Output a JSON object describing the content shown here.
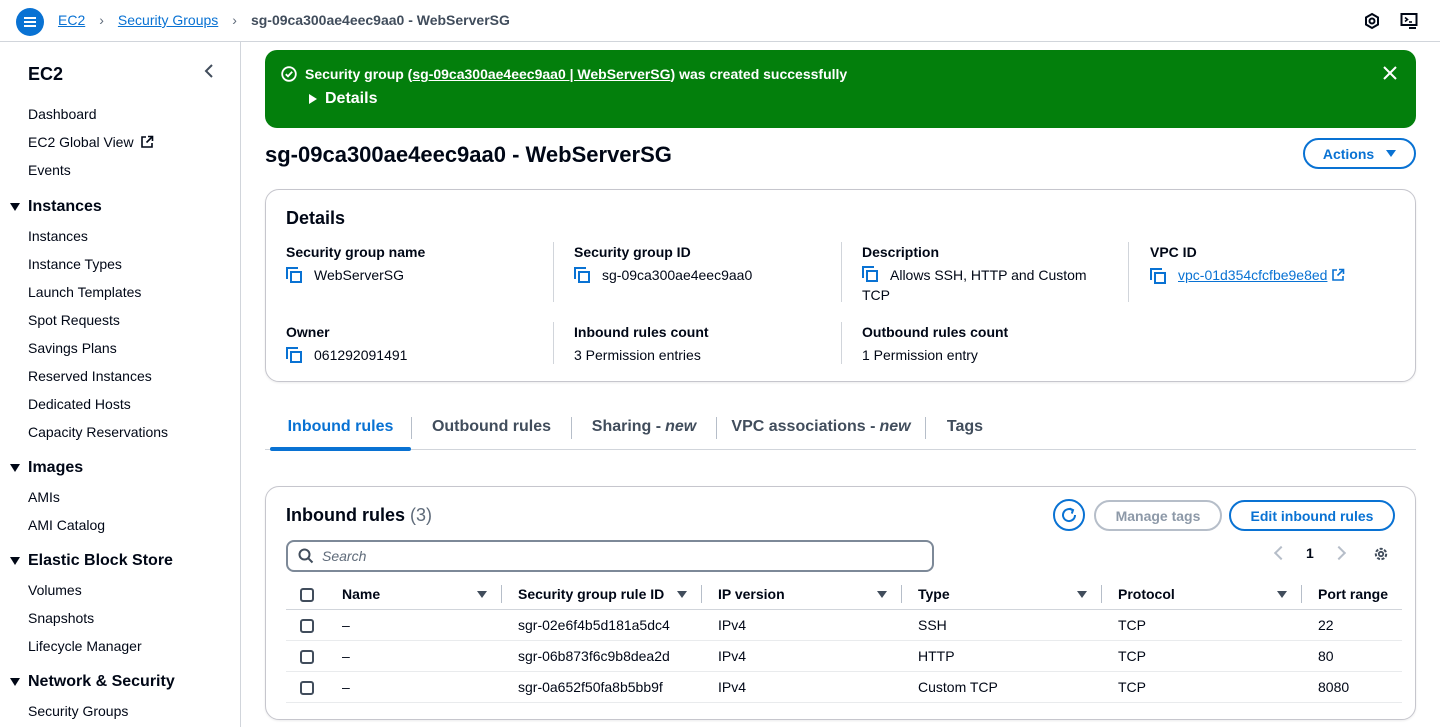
{
  "breadcrumb": {
    "root": "EC2",
    "section": "Security Groups",
    "current": "sg-09ca300ae4eec9aa0 - WebServerSG"
  },
  "topbar_icons": [
    "settings-hex-icon",
    "cloudshell-icon"
  ],
  "sidebar": {
    "title": "EC2",
    "top_items": [
      "Dashboard",
      "EC2 Global View",
      "Events"
    ],
    "sections": [
      {
        "title": "Instances",
        "items": [
          "Instances",
          "Instance Types",
          "Launch Templates",
          "Spot Requests",
          "Savings Plans",
          "Reserved Instances",
          "Dedicated Hosts",
          "Capacity Reservations"
        ]
      },
      {
        "title": "Images",
        "items": [
          "AMIs",
          "AMI Catalog"
        ]
      },
      {
        "title": "Elastic Block Store",
        "items": [
          "Volumes",
          "Snapshots",
          "Lifecycle Manager"
        ]
      },
      {
        "title": "Network & Security",
        "items": [
          "Security Groups"
        ]
      }
    ]
  },
  "flash": {
    "prefix": "Security group (",
    "link": "sg-09ca300ae4eec9aa0 | WebServerSG",
    "suffix": ") was created successfully",
    "details_label": "Details",
    "color": "#037f0c"
  },
  "page": {
    "title": "sg-09ca300ae4eec9aa0 - WebServerSG",
    "actions_label": "Actions"
  },
  "details": {
    "heading": "Details",
    "fields": {
      "sg_name": {
        "label": "Security group name",
        "value": "WebServerSG"
      },
      "sg_id": {
        "label": "Security group ID",
        "value": "sg-09ca300ae4eec9aa0"
      },
      "description": {
        "label": "Description",
        "value": "Allows SSH, HTTP and Custom TCP"
      },
      "vpc_id": {
        "label": "VPC ID",
        "value": "vpc-01d354cfcfbe9e8ed"
      },
      "owner": {
        "label": "Owner",
        "value": "061292091491"
      },
      "inbound_count": {
        "label": "Inbound rules count",
        "value": "3 Permission entries"
      },
      "outbound_count": {
        "label": "Outbound rules count",
        "value": "1 Permission entry"
      }
    }
  },
  "tabs": {
    "inbound": "Inbound rules",
    "outbound": "Outbound rules",
    "sharing": "Sharing -",
    "sharing_new": "new",
    "vpc_assoc": "VPC associations -",
    "vpc_assoc_new": "new",
    "tags": "Tags"
  },
  "inbound_rules": {
    "title": "Inbound rules",
    "count": "(3)",
    "manage_tags": "Manage tags",
    "edit": "Edit inbound rules",
    "search_placeholder": "Search",
    "page": "1",
    "columns": [
      "Name",
      "Security group rule ID",
      "IP version",
      "Type",
      "Protocol",
      "Port range"
    ],
    "rows": [
      {
        "name": "–",
        "rule_id": "sgr-02e6f4b5d181a5dc4",
        "ip": "IPv4",
        "type": "SSH",
        "protocol": "TCP",
        "port": "22"
      },
      {
        "name": "–",
        "rule_id": "sgr-06b873f6c9b8dea2d",
        "ip": "IPv4",
        "type": "HTTP",
        "protocol": "TCP",
        "port": "80"
      },
      {
        "name": "–",
        "rule_id": "sgr-0a652f50fa8b5bb9f",
        "ip": "IPv4",
        "type": "Custom TCP",
        "protocol": "TCP",
        "port": "8080"
      }
    ]
  },
  "accent": "#0972d3"
}
